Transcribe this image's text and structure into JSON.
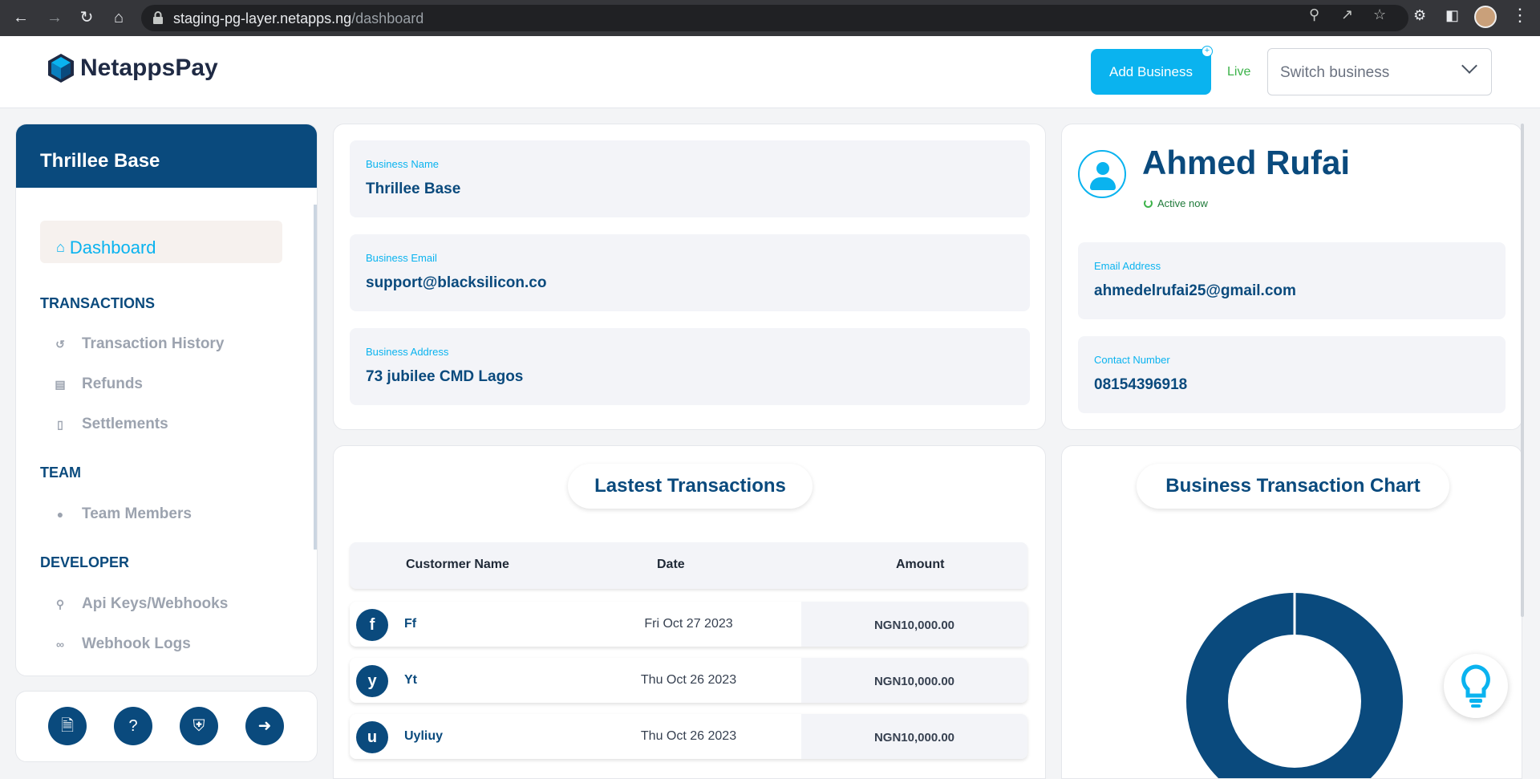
{
  "browser": {
    "url_host": "staging-pg-layer.netapps.ng",
    "url_path": "/dashboard"
  },
  "header": {
    "logo_text": "NetappsPay",
    "add_business_label": "Add Business",
    "mode_label": "Live",
    "switch_placeholder": "Switch business"
  },
  "sidebar": {
    "business_name": "Thrillee Base",
    "dashboard_label": "Dashboard",
    "sections": {
      "transactions": "TRANSACTIONS",
      "team": "TEAM",
      "developer": "DEVELOPER"
    },
    "items": {
      "transaction_history": "Transaction History",
      "refunds": "Refunds",
      "settlements": "Settlements",
      "team_members": "Team Members",
      "api_keys": "Api Keys/Webhooks",
      "webhook_logs": "Webhook Logs"
    }
  },
  "business": {
    "name_label": "Business Name",
    "name": "Thrillee Base",
    "email_label": "Business Email",
    "email": "support@blacksilicon.co",
    "address_label": "Business Address",
    "address": "73 jubilee CMD Lagos"
  },
  "user": {
    "name": "Ahmed Rufai",
    "status": "Active now",
    "email_label": "Email Address",
    "email": "ahmedelrufai25@gmail.com",
    "phone_label": "Contact Number",
    "phone": "08154396918"
  },
  "transactions": {
    "title": "Lastest Transactions",
    "columns": [
      "Custormer Name",
      "Date",
      "Amount"
    ],
    "rows": [
      {
        "initial": "f",
        "name": "Ff",
        "date": "Fri Oct 27 2023",
        "amount": "NGN10,000.00"
      },
      {
        "initial": "y",
        "name": "Yt",
        "date": "Thu Oct 26 2023",
        "amount": "NGN10,000.00"
      },
      {
        "initial": "u",
        "name": "Uyliuy",
        "date": "Thu Oct 26 2023",
        "amount": "NGN10,000.00"
      }
    ]
  },
  "chart": {
    "title": "Business Transaction Chart"
  },
  "colors": {
    "primary": "#0a4a7d",
    "accent": "#0ab3ef",
    "live": "#3cb34a"
  }
}
